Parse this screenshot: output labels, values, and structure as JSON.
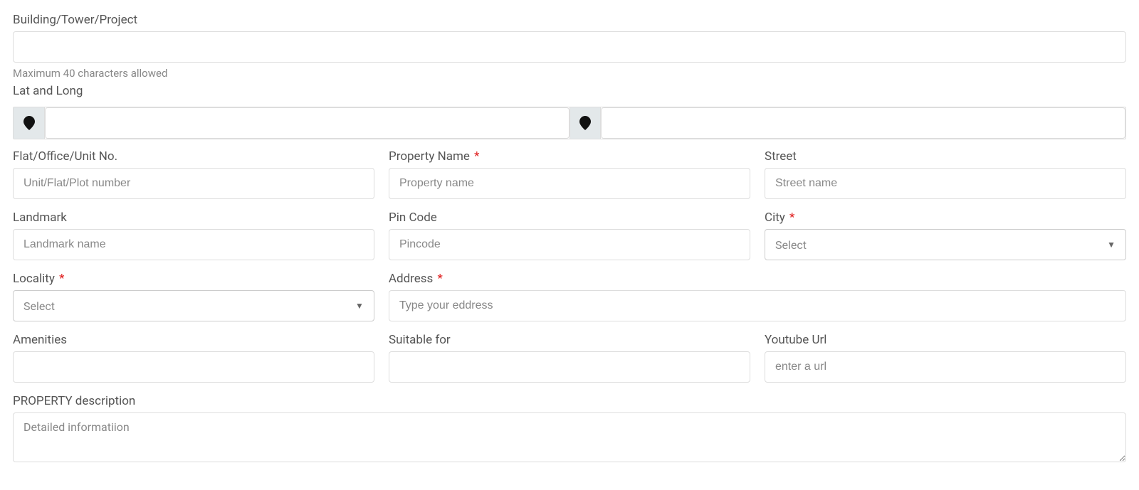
{
  "building": {
    "label": "Building/Tower/Project",
    "helper": "Maximum 40 characters allowed"
  },
  "latlong": {
    "label": "Lat and Long"
  },
  "unit": {
    "label": "Flat/Office/Unit No.",
    "placeholder": "Unit/Flat/Plot number"
  },
  "property_name": {
    "label": "Property Name",
    "placeholder": "Property name"
  },
  "street": {
    "label": "Street",
    "placeholder": "Street name"
  },
  "landmark": {
    "label": "Landmark",
    "placeholder": "Landmark name"
  },
  "pincode": {
    "label": "Pin Code",
    "placeholder": "Pincode"
  },
  "city": {
    "label": "City",
    "selected": "Select"
  },
  "locality": {
    "label": "Locality",
    "selected": "Select"
  },
  "address": {
    "label": "Address",
    "placeholder": "Type your eddress"
  },
  "amenities": {
    "label": "Amenities"
  },
  "suitable": {
    "label": "Suitable for"
  },
  "youtube": {
    "label": "Youtube Url",
    "placeholder": "enter a url"
  },
  "description": {
    "label": "PROPERTY description",
    "placeholder": "Detailed informatiion"
  },
  "required_marker": "*"
}
